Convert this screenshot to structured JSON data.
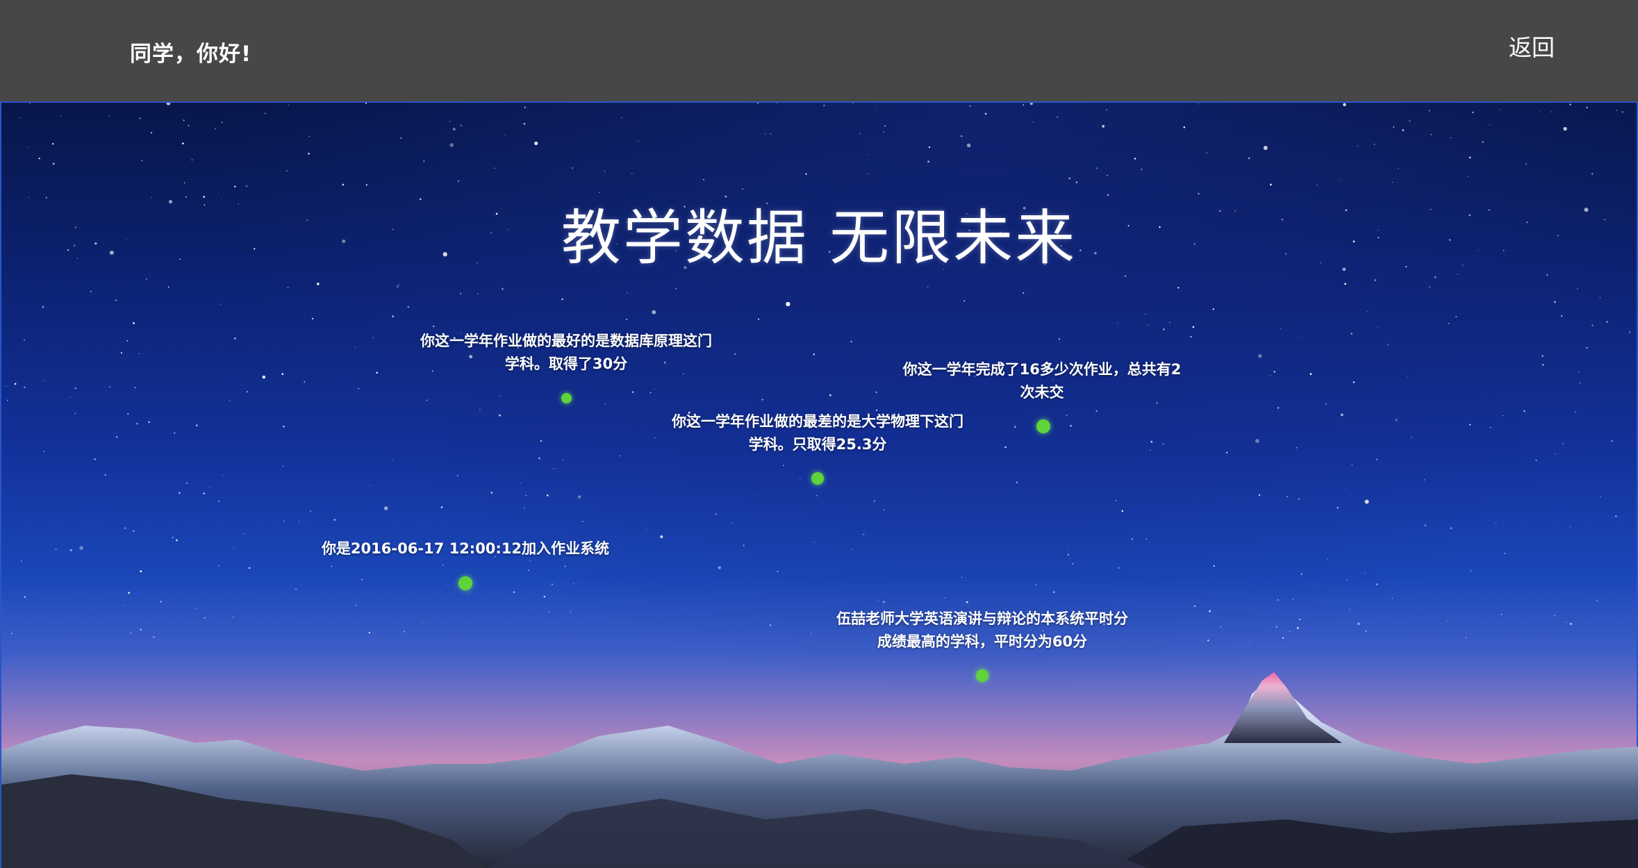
{
  "header": {
    "greeting": "同学，你好!",
    "back_label": "返回"
  },
  "hero": {
    "headline": "教学数据 无限未来"
  },
  "facts": [
    {
      "text": "你这一学年作业做的最好的是数据库原理这门学科。取得了30分"
    },
    {
      "text": "你这一学年完成了16多少次作业，总共有2次未交"
    },
    {
      "text": "你这一学年作业做的最差的是大学物理下这门学科。只取得25.3分"
    },
    {
      "text": "你是2016-06-17 12:00:12加入作业系统"
    },
    {
      "text": "伍喆老师大学英语演讲与辩论的本系统平时分成绩最高的学科，平时分为60分"
    }
  ],
  "colors": {
    "topbar": "#474747",
    "accent_border": "#2a56c6",
    "dot": "#5fd43a"
  }
}
